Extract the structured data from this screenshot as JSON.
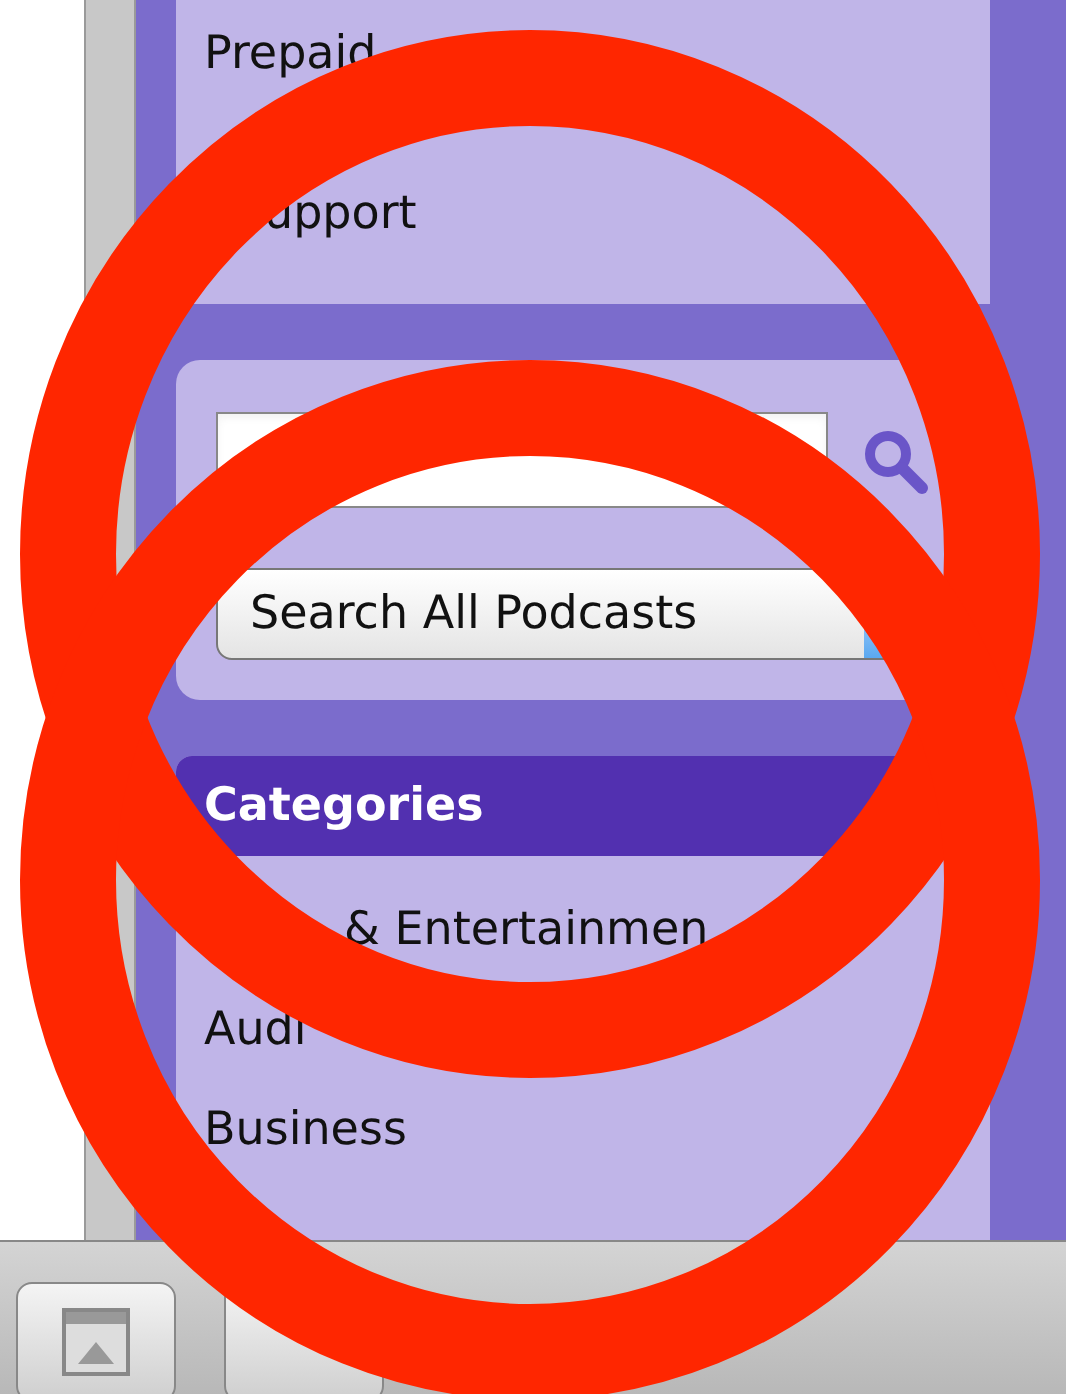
{
  "links": [
    {
      "label": "Prepaid"
    },
    {
      "label": "upport"
    }
  ],
  "search": {
    "scope": "Search All Podcasts"
  },
  "categories": {
    "title": "Categories",
    "items": [
      {
        "label": "& Entertainmen"
      },
      {
        "label": "Audi"
      },
      {
        "label": "Business"
      }
    ]
  },
  "annotations": [
    {
      "kind": "circle"
    },
    {
      "kind": "circle"
    }
  ]
}
